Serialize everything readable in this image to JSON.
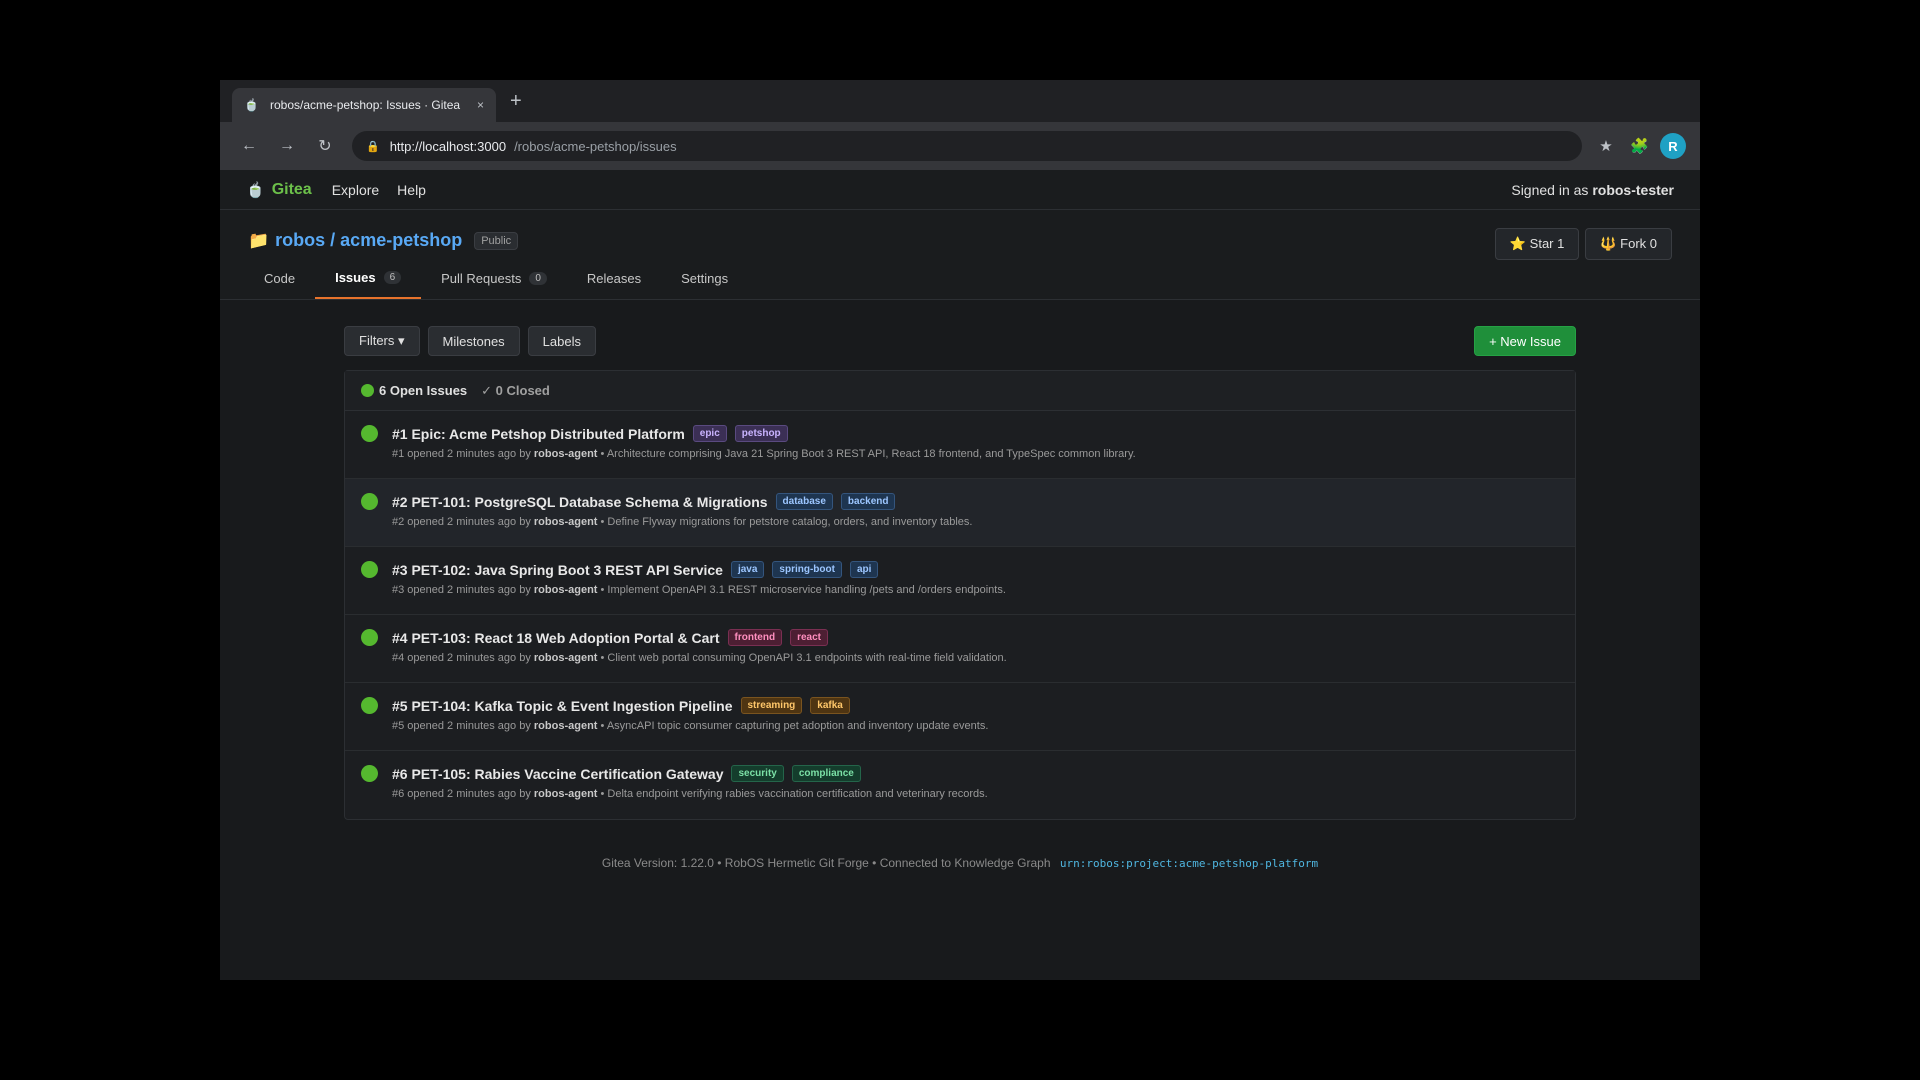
{
  "browser": {
    "tab_title": "robos/acme-petshop: Issues · Gitea",
    "tab_close": "×",
    "new_tab": "+",
    "url_host": "http://localhost:3000",
    "url_path": "/robos/acme-petshop/issues",
    "profile_initial": "R",
    "profile_color": "#1fa1c4"
  },
  "nav": {
    "brand": "Gitea",
    "explore": "Explore",
    "help": "Help",
    "signed_in_prefix": "Signed in as",
    "username": "robos-tester"
  },
  "repo": {
    "title": "robos / acme-petshop",
    "visibility": "Public",
    "star_label": "⭐ Star 1",
    "fork_label": "🔱 Fork 0",
    "tabs": [
      {
        "label": "Code",
        "count": ""
      },
      {
        "label": "Issues",
        "count": "6"
      },
      {
        "label": "Pull Requests",
        "count": "0"
      },
      {
        "label": "Releases",
        "count": ""
      },
      {
        "label": "Settings",
        "count": ""
      }
    ]
  },
  "toolbar": {
    "filters": "Filters ▾",
    "milestones": "Milestones",
    "labels": "Labels",
    "new_issue": "+ New Issue"
  },
  "issues_header": {
    "open": "6 Open Issues",
    "closed": "✓ 0 Closed"
  },
  "issues": [
    {
      "title": "#1 Epic: Acme Petshop Distributed Platform",
      "labels": [
        "epic",
        "petshop"
      ],
      "meta_prefix": "#1 opened 2 minutes ago by",
      "author": "robos-agent",
      "desc": "• Architecture comprising Java 21 Spring Boot 3 REST API, React 18 frontend, and TypeSpec common library."
    },
    {
      "title": "#2 PET-101: PostgreSQL Database Schema & Migrations",
      "labels": [
        "database",
        "backend"
      ],
      "meta_prefix": "#2 opened 2 minutes ago by",
      "author": "robos-agent",
      "desc": "• Define Flyway migrations for petstore catalog, orders, and inventory tables."
    },
    {
      "title": "#3 PET-102: Java Spring Boot 3 REST API Service",
      "labels": [
        "java",
        "spring-boot",
        "api"
      ],
      "meta_prefix": "#3 opened 2 minutes ago by",
      "author": "robos-agent",
      "desc": "• Implement OpenAPI 3.1 REST microservice handling /pets and /orders endpoints."
    },
    {
      "title": "#4 PET-103: React 18 Web Adoption Portal & Cart",
      "labels": [
        "frontend",
        "react"
      ],
      "meta_prefix": "#4 opened 2 minutes ago by",
      "author": "robos-agent",
      "desc": "• Client web portal consuming OpenAPI 3.1 endpoints with real-time field validation."
    },
    {
      "title": "#5 PET-104: Kafka Topic & Event Ingestion Pipeline",
      "labels": [
        "streaming",
        "kafka"
      ],
      "meta_prefix": "#5 opened 2 minutes ago by",
      "author": "robos-agent",
      "desc": "• AsyncAPI topic consumer capturing pet adoption and inventory update events."
    },
    {
      "title": "#6 PET-105: Rabies Vaccine Certification Gateway",
      "labels": [
        "security",
        "compliance"
      ],
      "meta_prefix": "#6 opened 2 minutes ago by",
      "author": "robos-agent",
      "desc": "• Delta endpoint verifying rabies vaccination certification and veterinary records."
    }
  ],
  "footer": {
    "text": "Gitea Version: 1.22.0 • RobOS Hermetic Git Forge • Connected to Knowledge Graph",
    "urn": "urn:robos:project:acme-petshop-platform"
  },
  "colors": {
    "open_status": "#55b82f",
    "brand": "#6cc04a",
    "primary_button": "#1f8f3a",
    "active_tab_underline": "#e8732c",
    "repo_link": "#59a9f5"
  },
  "icons": {
    "tab_favicon": "tea-icon",
    "back": "back-arrow-icon",
    "forward": "forward-arrow-icon",
    "reload": "reload-icon",
    "lock": "lock-icon",
    "bookmark": "star-icon",
    "extensions": "puzzle-icon",
    "repo": "folder-icon",
    "issue_open": "open-issue-icon"
  }
}
